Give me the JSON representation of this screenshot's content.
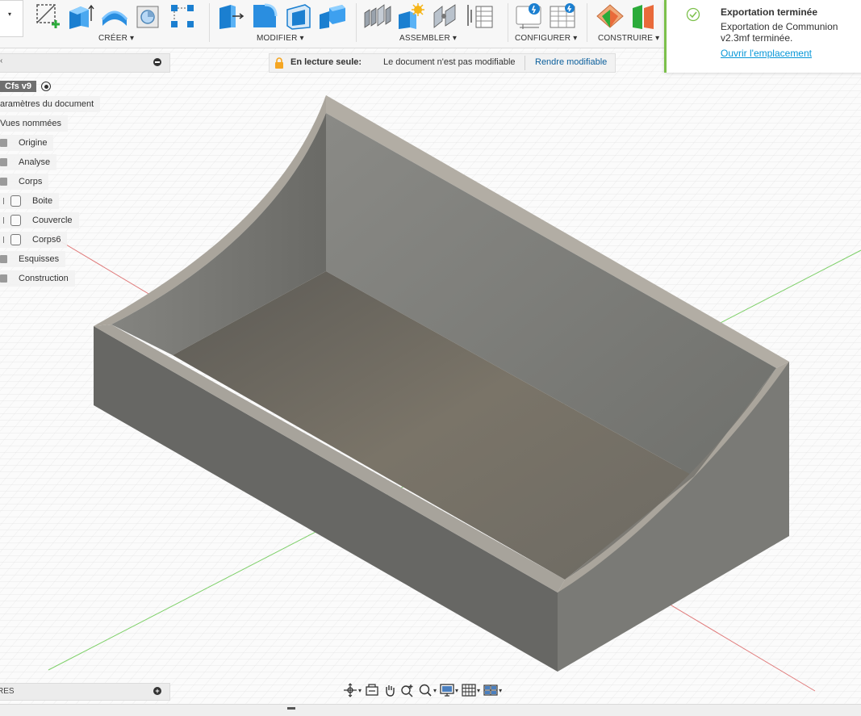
{
  "toolbar": {
    "groups": [
      {
        "label": "CRÉER ▾"
      },
      {
        "label": "MODIFIER ▾"
      },
      {
        "label": "ASSEMBLER ▾"
      },
      {
        "label": "CONFIGURER ▾"
      },
      {
        "label": "CONSTRUIRE ▾"
      }
    ]
  },
  "browser": {
    "root_label": "Cfs v9",
    "items": [
      {
        "label": "aramètres du document"
      },
      {
        "label": "Vues nommées"
      },
      {
        "label": "Origine"
      },
      {
        "label": "Analyse"
      },
      {
        "label": "Corps"
      },
      {
        "label": "Boite"
      },
      {
        "label": "Couvercle"
      },
      {
        "label": "Corps6"
      },
      {
        "label": "Esquisses"
      },
      {
        "label": "Construction"
      }
    ],
    "bottom_label": "RES"
  },
  "readonly": {
    "title": "En lecture seule:",
    "message": "Le document n'est pas modifiable",
    "action": "Rendre modifiable"
  },
  "notification": {
    "title": "Exportation terminée",
    "body_line1": "Exportation de Communion",
    "body_line2": "v2.3mf terminée.",
    "link": "Ouvrir l'emplacement"
  },
  "nav_icons": [
    "orbit-icon",
    "look-at-icon",
    "pan-icon",
    "zoom-icon",
    "fit-icon",
    "display-settings-icon",
    "grid-settings-icon",
    "viewports-icon"
  ],
  "colors": {
    "accent": "#0696d7",
    "success": "#7cc04b",
    "model_top": "#b8b2a8",
    "model_side": "#6c6c68"
  }
}
